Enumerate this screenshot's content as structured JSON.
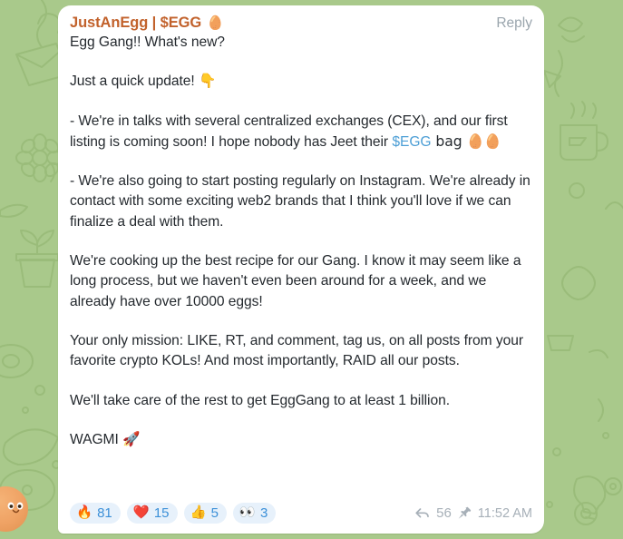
{
  "app": "telegram-chat",
  "theme": {
    "background_color": "#a9c98b",
    "bubble_color": "#ffffff",
    "author_color": "#c2622c",
    "link_color": "#4d9fd6",
    "reaction_chip_color": "#e7f1fb",
    "reaction_text_color": "#3c90d8",
    "meta_color": "#a7b0b8",
    "body_text_color": "#24292e"
  },
  "message": {
    "author": "JustAnEgg | $EGG",
    "author_badge_emoji": "🥚",
    "reply_label": "Reply",
    "paragraphs": [
      {
        "id": "p1",
        "text": "Egg Gang!! What's new?"
      },
      {
        "id": "p2",
        "text": "Just a quick update! 👇"
      },
      {
        "id": "p3",
        "prefix": "- We're in talks with several centralized exchanges (CEX), and our first listing is coming soon! I hope nobody has Jeet their ",
        "link": "$EGG",
        "suffix": " bag 🥚🥚"
      },
      {
        "id": "p4",
        "text": "- We're also going to start posting regularly on Instagram. We're already in contact with some exciting web2 brands that I think you'll love if we can finalize a deal with them."
      },
      {
        "id": "p5",
        "text": "We're cooking up the best recipe for our Gang. I know it may seem like a long process, but we haven't even been around for a week, and we already have over 10000 eggs!"
      },
      {
        "id": "p6",
        "text": "Your only mission:  LIKE, RT, and comment, tag us, on all posts from your favorite crypto KOLs! And most importantly, RAID all our posts."
      },
      {
        "id": "p7",
        "text": "We'll take care of the rest to get EggGang to at least 1 billion."
      },
      {
        "id": "p8",
        "text": "WAGMI 🚀"
      }
    ],
    "reactions": [
      {
        "emoji": "🔥",
        "name": "fire-reaction",
        "count": "81"
      },
      {
        "emoji": "❤️",
        "name": "heart-reaction",
        "count": "15"
      },
      {
        "emoji": "👍",
        "name": "thumbs-up-reaction",
        "count": "5"
      },
      {
        "emoji": "👀",
        "name": "eyes-reaction",
        "count": "3"
      }
    ],
    "meta": {
      "reply_count": "56",
      "pinned": true,
      "timestamp": "11:52 AM"
    }
  }
}
